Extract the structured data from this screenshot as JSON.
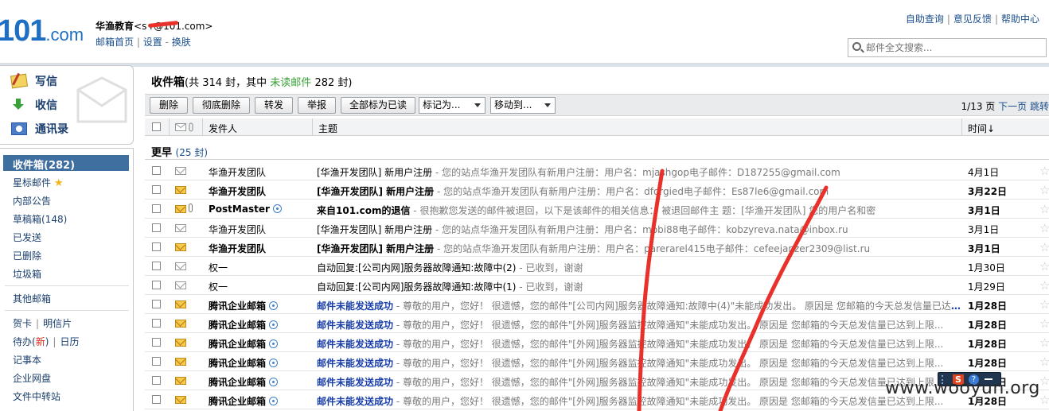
{
  "header": {
    "logo_main": "101",
    "logo_suffix": ".com",
    "account_name": "华渔教育",
    "account_email": "<s       r@101.com>",
    "nav_home": "邮箱首页",
    "nav_settings": "设置",
    "nav_switch": "换肤",
    "top_links": [
      "自助查询",
      "意见反馈",
      "帮助中心"
    ],
    "search_placeholder": "邮件全文搜索..."
  },
  "sidebar": {
    "compose": "写信",
    "receive": "收信",
    "contacts": "通讯录",
    "folders": [
      {
        "label": "收件箱(282)"
      },
      {
        "label": "星标邮件"
      },
      {
        "label": "内部公告"
      },
      {
        "label": "草稿箱(148)"
      },
      {
        "label": "已发送"
      },
      {
        "label": "已删除"
      },
      {
        "label": "垃圾箱"
      },
      {
        "label": "其他邮箱"
      }
    ],
    "tools": {
      "card": "贺卡",
      "postcard": "明信片",
      "todo_prefix": "待办(",
      "todo_new": "新",
      "todo_suffix": ")",
      "calendar": "日历",
      "notebook": "记事本",
      "netdisk": "企业网盘",
      "transfer": "文件中转站"
    }
  },
  "main": {
    "folder_title": "收件箱",
    "summary_prefix": "(共 314 封，其中 ",
    "summary_unread": "未读邮件",
    "summary_suffix": " 282 封)",
    "toolbar": {
      "delete": "删除",
      "purge": "彻底删除",
      "forward": "转发",
      "report": "举报",
      "mark_all_read": "全部标为已读",
      "mark_as": "标记为...",
      "move_to": "移动到..."
    },
    "pager": {
      "page_info": "1/13 页",
      "next": "下一页",
      "jump": "跳转"
    },
    "columns": {
      "sender": "发件人",
      "subject": "主题",
      "time": "时间↓"
    },
    "group": {
      "label": "更早",
      "count": "(25 封)"
    },
    "emails": [
      {
        "sender": "华渔开发团队",
        "subject": "[华渔开发团队] 新用户注册",
        "preview": " - 您的站点华渔开发团队有新用户注册：用户名：mjashgop电子邮件：D187255@gmail.com",
        "date": "4月1日",
        "unread": false,
        "attach": false,
        "badge": false,
        "blue": false
      },
      {
        "sender": "华渔开发团队",
        "subject": "[华渔开发团队] 新用户注册",
        "preview": " - 您的站点华渔开发团队有新用户注册：用户名：dforgied电子邮件：Es87le6@gmail.com",
        "date": "3月22日",
        "unread": true,
        "attach": false,
        "badge": false,
        "blue": false
      },
      {
        "sender": "PostMaster",
        "subject": "来自101.com的退信",
        "preview": " - 很抱歉您发送的邮件被退回，以下是该邮件的相关信息： 被退回邮件主 题：[华渔开发团队] 您的用户名和密",
        "date": "3月1日",
        "unread": true,
        "attach": true,
        "badge": true,
        "blue": false
      },
      {
        "sender": "华渔开发团队",
        "subject": "[华渔开发团队] 新用户注册",
        "preview": " - 您的站点华渔开发团队有新用户注册：用户名：mobi88电子邮件：kobzyreva.nata@inbox.ru",
        "date": "3月1日",
        "unread": false,
        "attach": false,
        "badge": false,
        "blue": false
      },
      {
        "sender": "华渔开发团队",
        "subject": "[华渔开发团队] 新用户注册",
        "preview": " - 您的站点华渔开发团队有新用户注册：用户名：parerarel415电子邮件：cefeejanzer2309@list.ru",
        "date": "3月1日",
        "unread": true,
        "attach": false,
        "badge": false,
        "blue": false
      },
      {
        "sender": "权一",
        "subject": "自动回复:[公司内网]服务器故障通知:故障中(2)",
        "preview": " - 已收到，谢谢",
        "date": "1月30日",
        "unread": false,
        "attach": false,
        "badge": false,
        "blue": false
      },
      {
        "sender": "权一",
        "subject": "自动回复:[公司内网]服务器故障通知:故障中(1)",
        "preview": " - 已收到，谢谢",
        "date": "1月29日",
        "unread": false,
        "attach": false,
        "badge": false,
        "blue": false
      },
      {
        "sender": "腾讯企业邮箱",
        "subject": "邮件未能发送成功",
        "preview": " - 尊敬的用户，您好！ 很遗憾，您的邮件\"[公司内网]服务器故障通知:故障中(4)\"未能成功发出。 原因是 您邮箱的今天总发信量已达到上限...",
        "date": "1月28日",
        "unread": true,
        "attach": false,
        "badge": true,
        "blue": true
      },
      {
        "sender": "腾讯企业邮箱",
        "subject": "邮件未能发送成功",
        "preview": " - 尊敬的用户，您好！ 很遗憾，您的邮件\"[外网]服务器监控故障通知\"未能成功发出。 原因是 您邮箱的今天总发信量已达到上限...",
        "date": "1月28日",
        "unread": true,
        "attach": false,
        "badge": true,
        "blue": true
      },
      {
        "sender": "腾讯企业邮箱",
        "subject": "邮件未能发送成功",
        "preview": " - 尊敬的用户，您好！ 很遗憾，您的邮件\"[外网]服务器监控故障通知\"未能成功发出。 原因是 您邮箱的今天总发信量已达到上限...",
        "date": "1月28日",
        "unread": true,
        "attach": false,
        "badge": true,
        "blue": true
      },
      {
        "sender": "腾讯企业邮箱",
        "subject": "邮件未能发送成功",
        "preview": " - 尊敬的用户，您好！ 很遗憾，您的邮件\"[外网]服务器监控故障通知\"未能成功发出。 原因是 您邮箱的今天总发信量已达到上限...",
        "date": "1月28日",
        "unread": true,
        "attach": false,
        "badge": true,
        "blue": true
      },
      {
        "sender": "腾讯企业邮箱",
        "subject": "邮件未能发送成功",
        "preview": " - 尊敬的用户，您好！ 很遗憾，您的邮件\"[外网]服务器监控故障通知\"未能成功发出。 原因是 您邮箱的今天总发信量已达到上限...",
        "date": "1月28日",
        "unread": true,
        "attach": false,
        "badge": true,
        "blue": true
      },
      {
        "sender": "腾讯企业邮箱",
        "subject": "邮件未能发送成功",
        "preview": " - 尊敬的用户，您好！ 很遗憾，您的邮件\"[外网]服务器监控故障通知\"未能成功发出。 原因是 您邮箱的今天总发信量已达到上限...",
        "date": "1月28日",
        "unread": true,
        "attach": false,
        "badge": true,
        "blue": true
      }
    ]
  },
  "watermark": "www.wooyun.org",
  "colors": {
    "accent": "#1a4d8c",
    "active_folder": "#3f6f9f",
    "unread_green": "#37a037",
    "scribble": "#e8312a"
  }
}
